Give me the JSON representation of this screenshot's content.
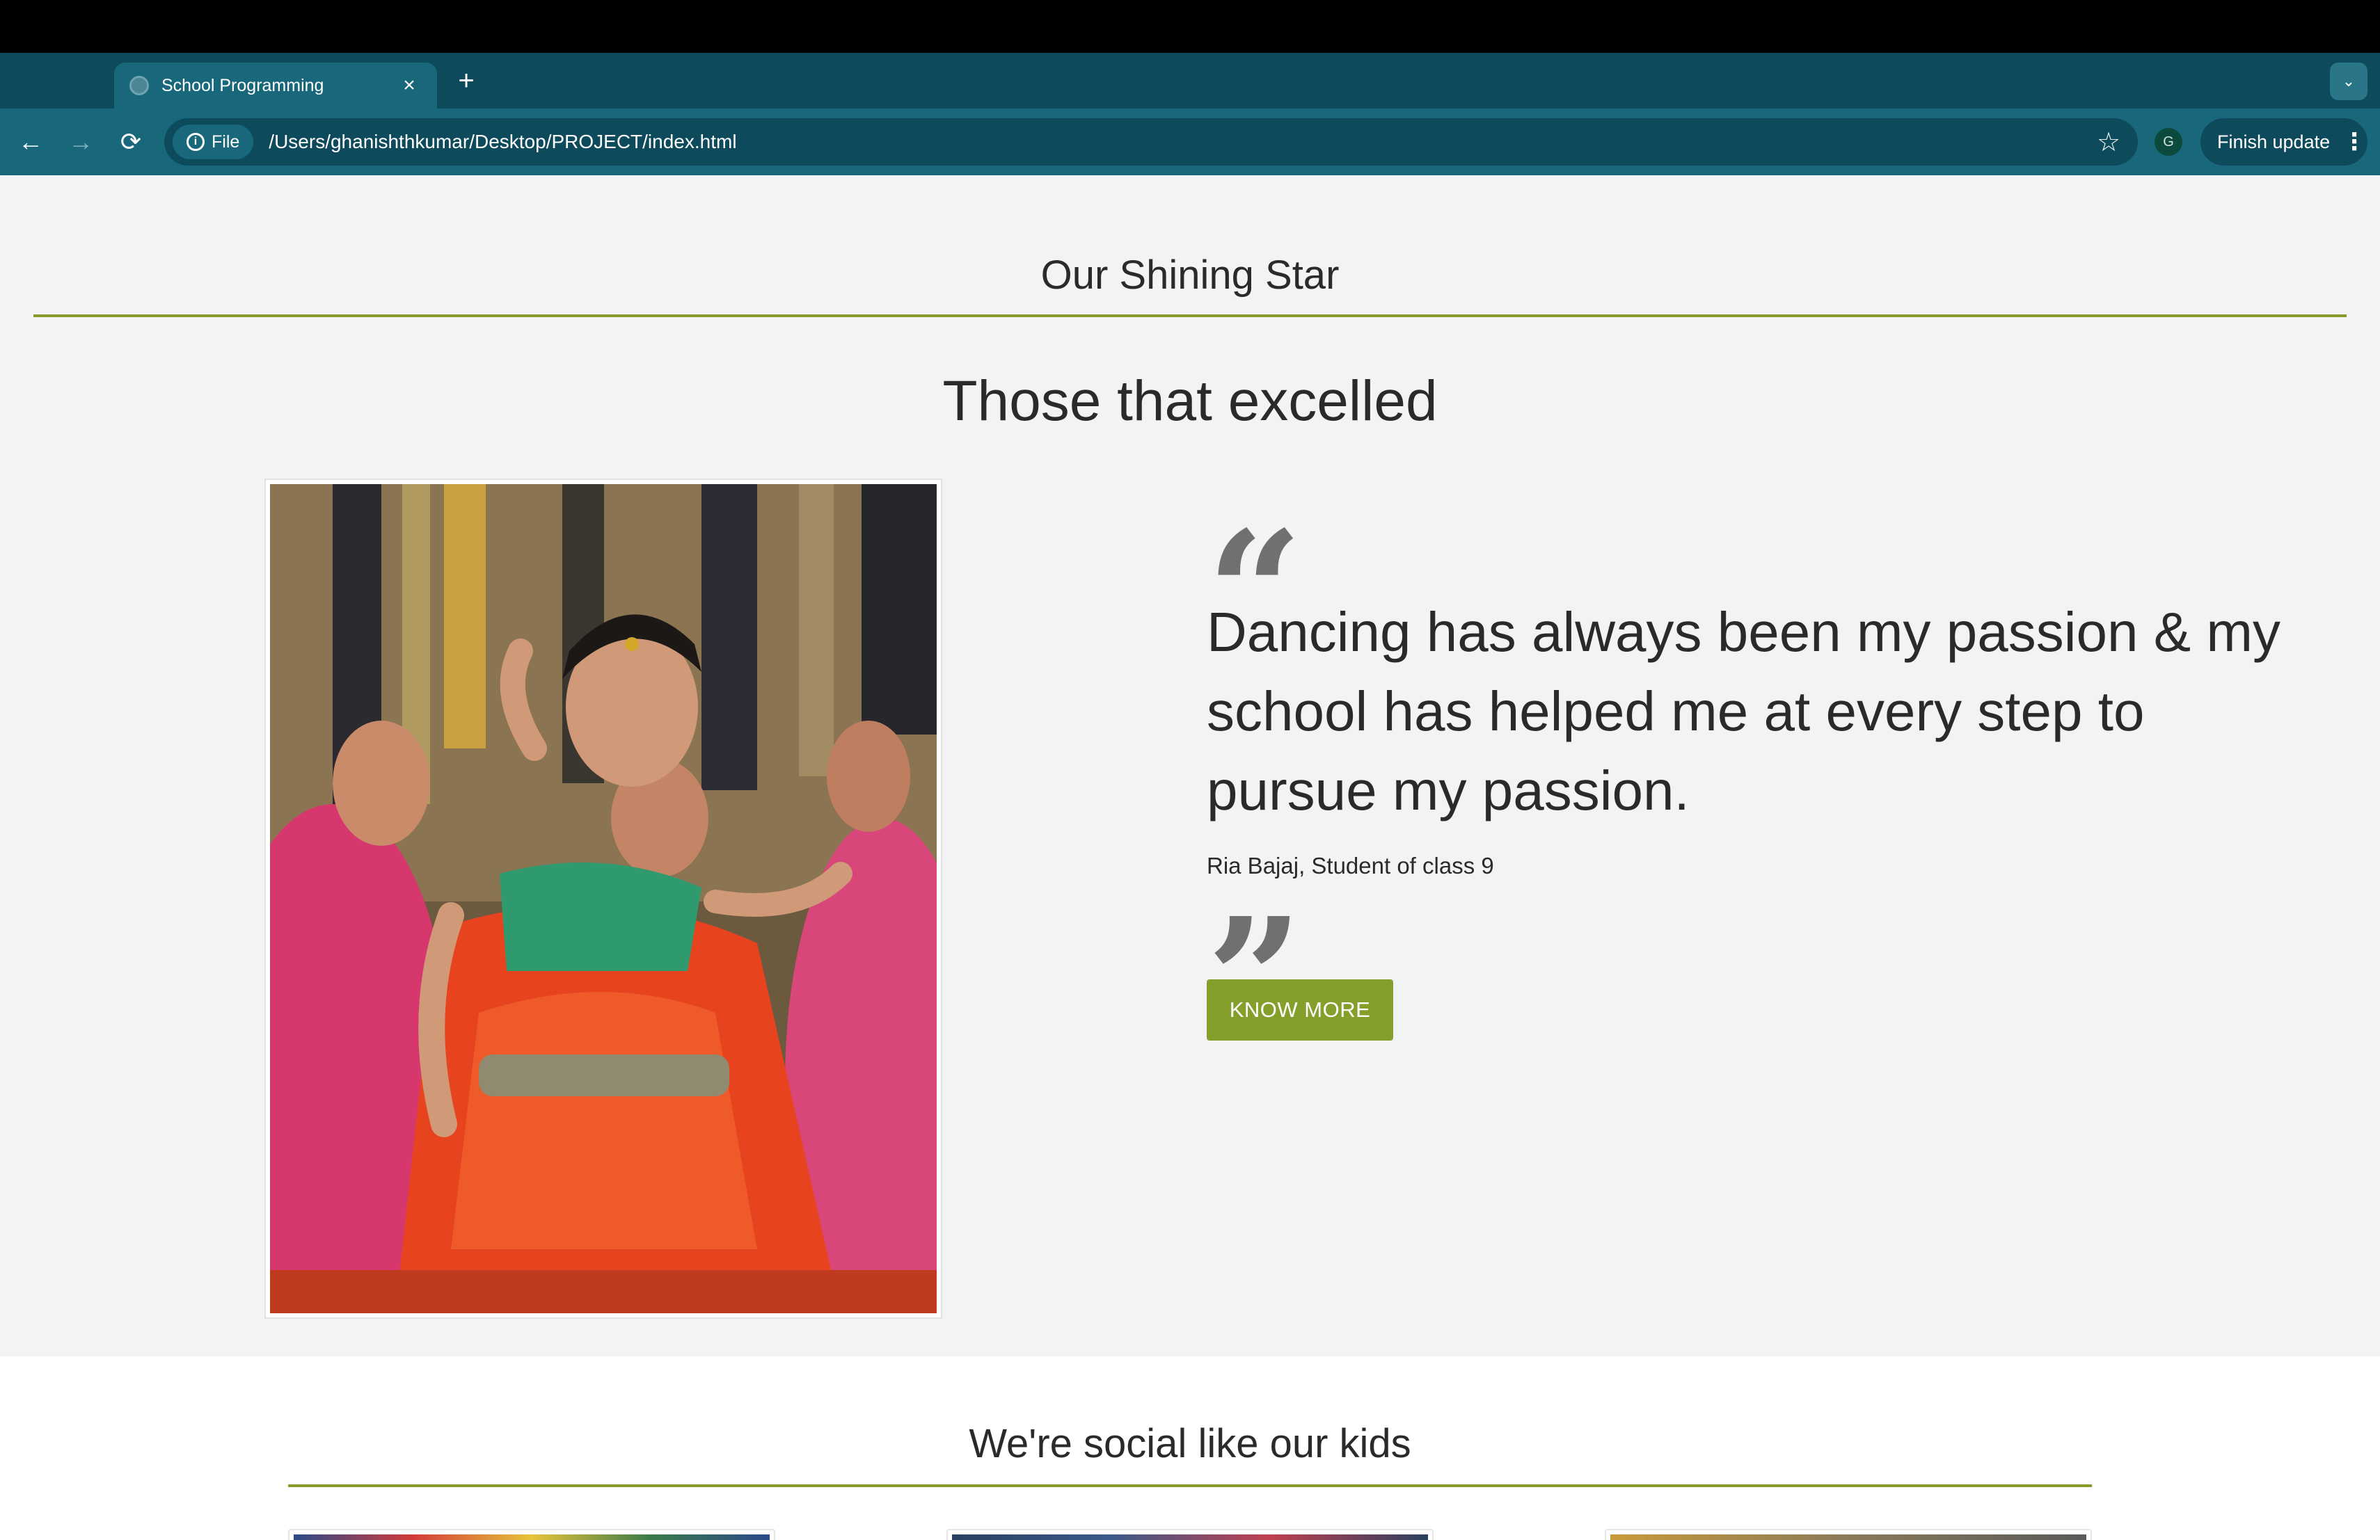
{
  "browser": {
    "tab_title": "School Programming",
    "tab_close": "×",
    "new_tab": "+",
    "tab_menu": "⌄",
    "back": "←",
    "forward": "→",
    "reload": "⟳",
    "file_chip": "File",
    "url": "/Users/ghanishthkumar/Desktop/PROJECT/index.html",
    "bookmark_star": "☆",
    "profile_initial": "G",
    "finish_update": "Finish update",
    "menu_dots": "⋮"
  },
  "page": {
    "section_title": "Our Shining Star",
    "headline": "Those that excelled",
    "quote_open": "“",
    "quote": "Dancing has always been my passion & my school has helped me at every step to pursue my passion.",
    "attribution": "Ria Bajaj, Student of class 9",
    "quote_close": "”",
    "cta_label": "KNOW MORE",
    "social_title": "We're social like our kids"
  },
  "colors": {
    "accent": "#84a02b",
    "rule": "#8a9a2a",
    "chrome_dark": "#0d4a5c",
    "chrome_light": "#18677a",
    "page_bg": "#f2f3f5"
  },
  "icons": {
    "photo": "dancer-photo",
    "quote_open": "quote-open-icon",
    "quote_close": "quote-close-icon"
  }
}
